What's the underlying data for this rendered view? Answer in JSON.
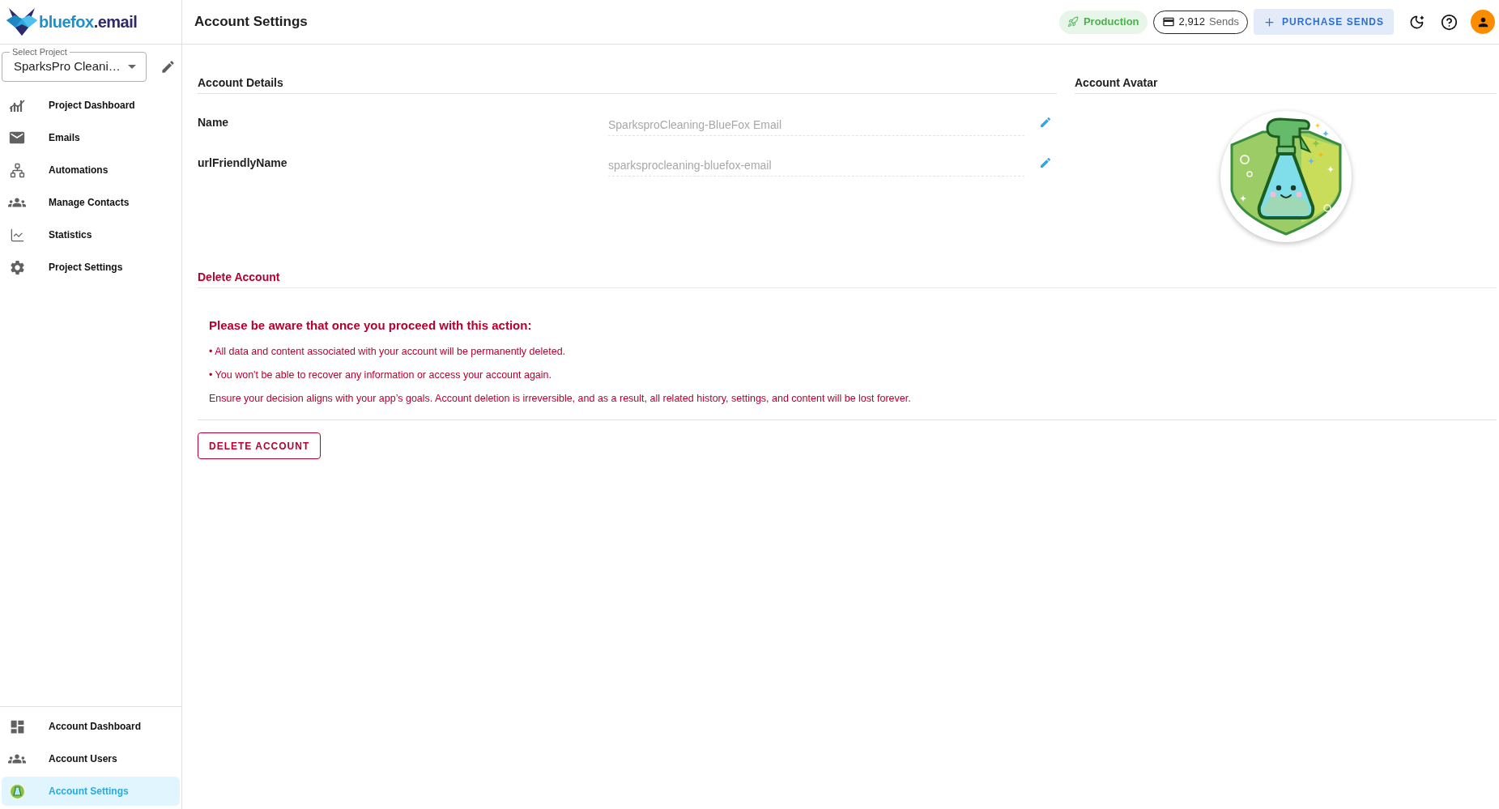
{
  "sidebar": {
    "logo": {
      "name": "bluefox",
      "suffix": ".email"
    },
    "project_select": {
      "label": "Select Project",
      "value": "SparksPro Cleani…"
    },
    "nav_items": [
      {
        "label": "Project Dashboard",
        "selected": false
      },
      {
        "label": "Emails",
        "selected": false
      },
      {
        "label": "Automations",
        "selected": false
      },
      {
        "label": "Manage Contacts",
        "selected": false
      },
      {
        "label": "Statistics",
        "selected": false
      },
      {
        "label": "Project Settings",
        "selected": false
      }
    ],
    "account_items": [
      {
        "label": "Account Dashboard",
        "selected": false
      },
      {
        "label": "Account Users",
        "selected": false
      },
      {
        "label": "Account Settings",
        "selected": true
      }
    ]
  },
  "header": {
    "title": "Account Settings",
    "environment": "Production",
    "sends": {
      "count": "2,912",
      "unit": "Sends"
    },
    "purchase_button": "PURCHASE SENDS"
  },
  "account_details": {
    "title": "Account Details",
    "fields": [
      {
        "label": "Name",
        "value": "SparksproCleaning-BlueFox Email",
        "disabled": true
      },
      {
        "label": "urlFriendlyName",
        "value": "sparksprocleaning-bluefox-email",
        "disabled": true
      }
    ]
  },
  "account_avatar": {
    "title": "Account Avatar"
  },
  "delete_account": {
    "title": "Delete Account",
    "warning": {
      "title": "Please be aware that once you proceed with this action:",
      "points": [
        "• All data and content associated with your account will be permanently deleted.",
        "• You won't be able to recover any information or access your account again."
      ],
      "note": "Ensure your decision aligns with your app’s goals. Account deletion is irreversible, and as a result, all related history, settings, and content will be lost forever."
    },
    "button": "DELETE ACCOUNT"
  }
}
